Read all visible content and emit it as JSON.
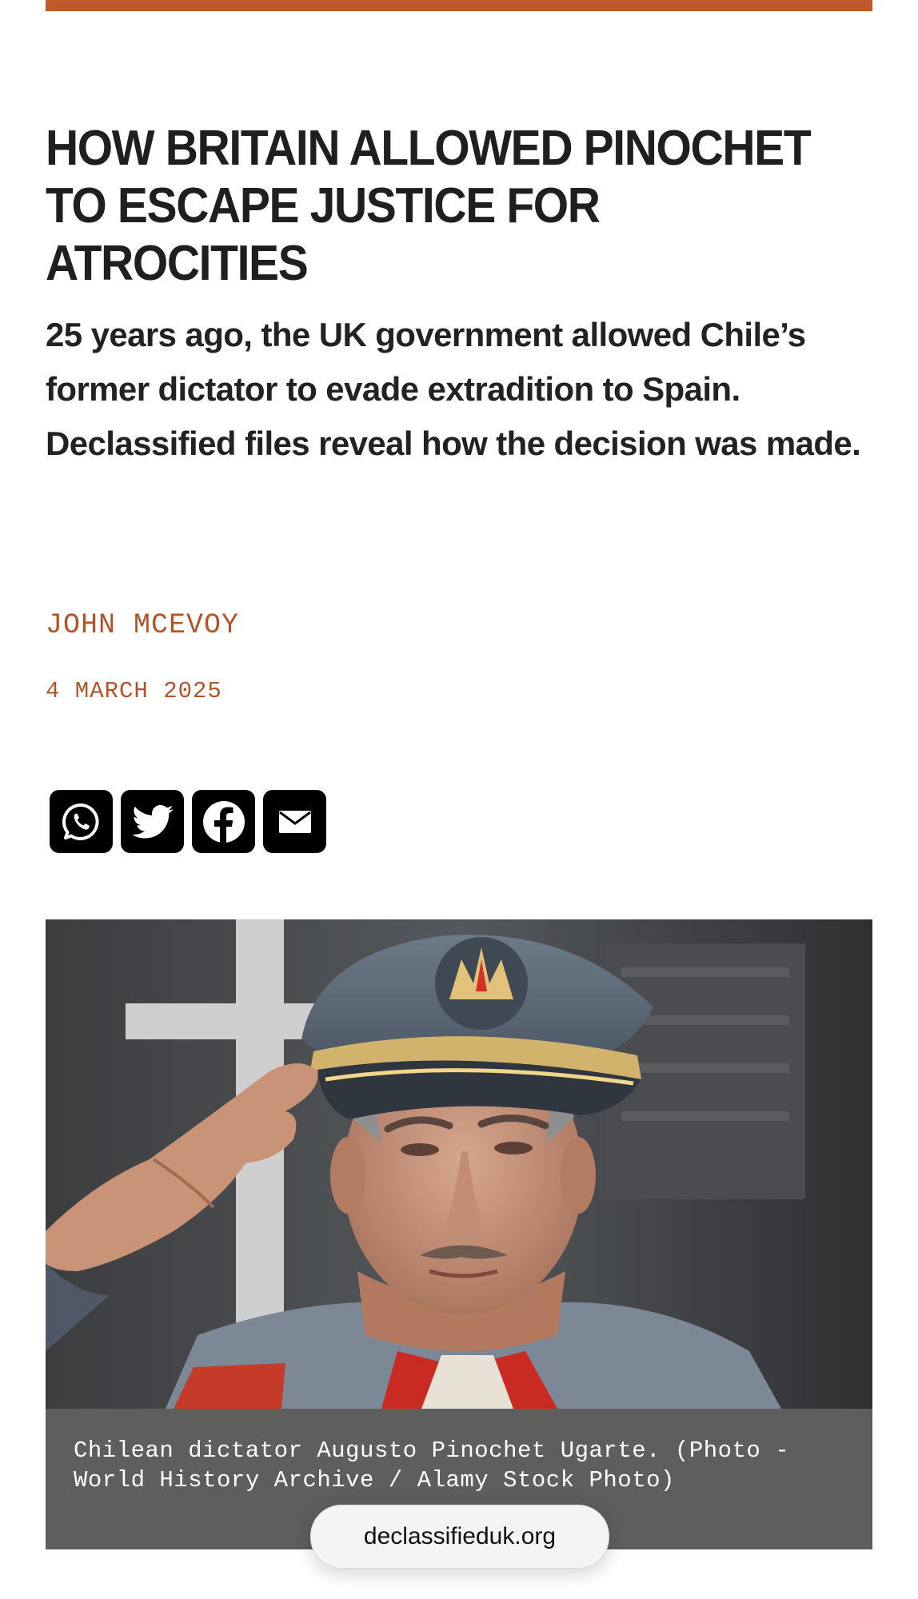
{
  "article": {
    "headline": "HOW BRITAIN ALLOWED PINOCHET TO ESCAPE JUSTICE FOR ATROCITIES",
    "standfirst": "25 years ago, the UK government allowed Chile’s former dictator to evade extradition to Spain. Declassified files reveal how the decision was made.",
    "author": "JOHN MCEVOY",
    "date": "4 MARCH 2025"
  },
  "share": {
    "buttons": [
      {
        "name": "whatsapp",
        "icon": "whatsapp-icon"
      },
      {
        "name": "twitter",
        "icon": "twitter-icon"
      },
      {
        "name": "facebook",
        "icon": "facebook-icon"
      },
      {
        "name": "email",
        "icon": "email-icon"
      }
    ]
  },
  "figure": {
    "caption": "Chilean dictator Augusto Pinochet Ugarte. (Photo - World History Archive / Alamy Stock Photo)"
  },
  "browser": {
    "url": "declassifieduk.org"
  },
  "colors": {
    "accent": "#c0592b",
    "meta_text": "#b0552a",
    "caption_bg": "#5e5e5e"
  }
}
